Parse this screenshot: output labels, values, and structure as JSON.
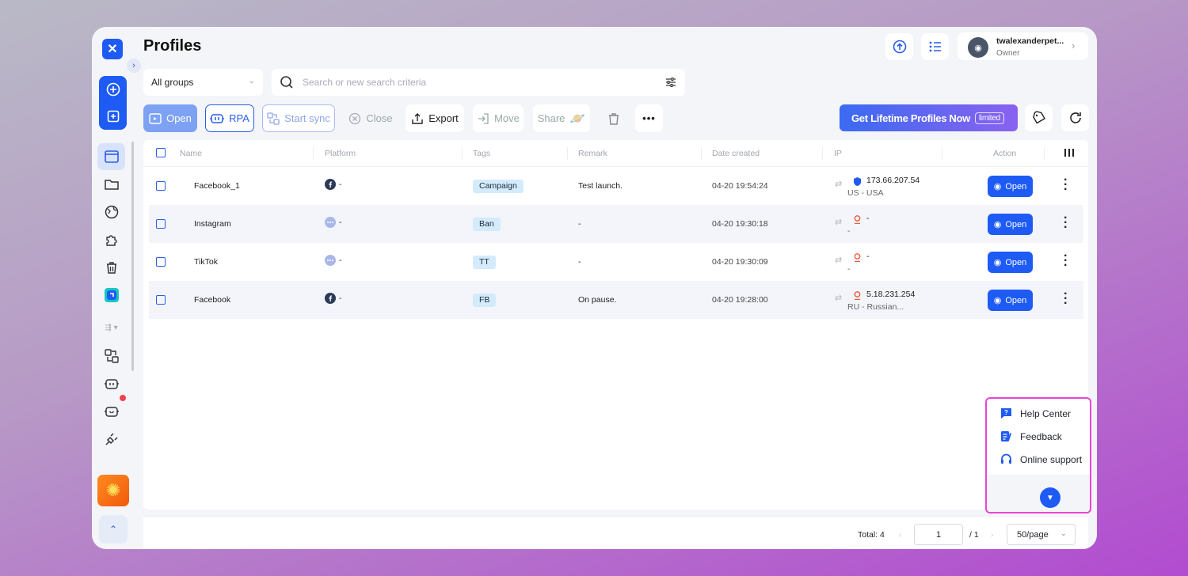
{
  "page": {
    "title": "Profiles"
  },
  "user": {
    "name": "twalexanderpet...",
    "role": "Owner"
  },
  "filters": {
    "group": "All groups",
    "search_placeholder": "Search or new search criteria"
  },
  "toolbar": {
    "open": "Open",
    "rpa": "RPA",
    "start_sync": "Start sync",
    "close": "Close",
    "export": "Export",
    "move": "Move",
    "share": "Share",
    "more": "•••"
  },
  "promo": {
    "text": "Get Lifetime Profiles Now",
    "badge": "limited"
  },
  "table": {
    "headers": [
      "Name",
      "Platform",
      "Tags",
      "Remark",
      "Date created",
      "IP",
      "Action"
    ],
    "rows": [
      {
        "name": "Facebook_1",
        "platform": "facebook",
        "platform_text": "-",
        "tag": "Campaign",
        "remark": "Test launch.",
        "date": "04-20 19:54:24",
        "ip": "173.66.207.54",
        "location": "US - USA",
        "action": "Open"
      },
      {
        "name": "Instagram",
        "platform": "other",
        "platform_text": "-",
        "tag": "Ban",
        "remark": "-",
        "date": "04-20 19:30:18",
        "ip": "-",
        "location": "-",
        "action": "Open"
      },
      {
        "name": "TikTok",
        "platform": "other",
        "platform_text": "-",
        "tag": "TT",
        "remark": "-",
        "date": "04-20 19:30:09",
        "ip": "-",
        "location": "-",
        "action": "Open"
      },
      {
        "name": "Facebook",
        "platform": "facebook",
        "platform_text": "-",
        "tag": "FB",
        "remark": "On pause.",
        "date": "04-20 19:28:00",
        "ip": "5.18.231.254",
        "location": "RU - Russian...",
        "action": "Open"
      }
    ]
  },
  "pagination": {
    "total": "Total: 4",
    "page": "1",
    "of": "/ 1",
    "size": "50/page"
  },
  "help_menu": {
    "items": [
      "Help Center",
      "Feedback",
      "Online support"
    ]
  },
  "colors": {
    "accent": "#1e5bf5",
    "tag_bg": "#d3ebfb",
    "highlight_border": "#e845d3"
  }
}
